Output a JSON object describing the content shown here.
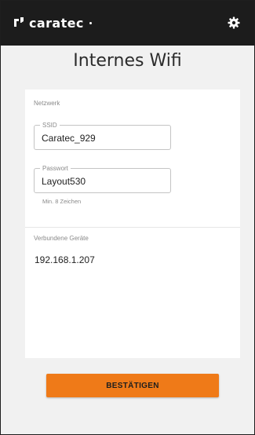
{
  "header": {
    "brand": "caratec",
    "logo_icon": "caratec-logo-icon",
    "settings_icon": "gear-icon",
    "background": "#1c1c1c"
  },
  "page": {
    "title": "Internes Wifi"
  },
  "network": {
    "section_label": "Netzwerk",
    "ssid_label": "SSID",
    "ssid_value": "Caratec_929",
    "password_label": "Passwort",
    "password_value": "Layout530",
    "password_hint": "Min. 8 Zeichen"
  },
  "devices": {
    "section_label": "Verbundene Geräte",
    "items": [
      "192.168.1.207"
    ]
  },
  "actions": {
    "confirm_label": "BESTÄTIGEN",
    "accent": "#ef7a18"
  }
}
